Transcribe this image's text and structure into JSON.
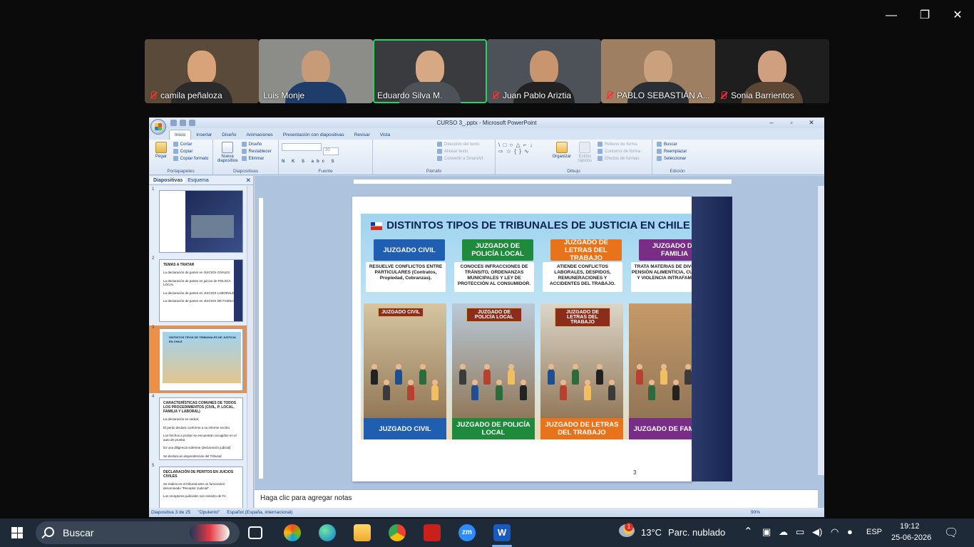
{
  "participants": [
    {
      "name": "camila peñaloza",
      "muted": true,
      "active": false,
      "bg": "#5a4a3a",
      "face": "#d9a37a",
      "body": "#2b2b2b"
    },
    {
      "name": "Luis Monje",
      "muted": false,
      "active": false,
      "bg": "#8c8c88",
      "face": "#c79b78",
      "body": "#1f3d6b"
    },
    {
      "name": "Eduardo Silva M.",
      "muted": false,
      "active": true,
      "bg": "#3a3b3f",
      "face": "#d6a883",
      "body": "#4c5258"
    },
    {
      "name": "Juan Pablo Ariztia",
      "muted": true,
      "active": false,
      "bg": "#4d5258",
      "face": "#c9956f",
      "body": "#222"
    },
    {
      "name": "PABLO SEBASTIÁN A...",
      "muted": true,
      "active": false,
      "bg": "#9e7f62",
      "face": "#caa07d",
      "body": "#2a2f35"
    },
    {
      "name": "Sonia Barrientos",
      "muted": true,
      "active": false,
      "bg": "#1e1e1e",
      "face": "#cf9f80",
      "body": "#5b4633"
    }
  ],
  "ppt": {
    "title": "CURSO 3_.pptx - Microsoft PowerPoint",
    "tabs": [
      "Inicio",
      "Insertar",
      "Diseño",
      "Animaciones",
      "Presentación con diapositivas",
      "Revisar",
      "Vista"
    ],
    "groups": {
      "portapapeles": {
        "label": "Portapapeles",
        "pegar": "Pegar",
        "cortar": "Cortar",
        "copiar": "Copiar",
        "copiar_formato": "Copiar formato"
      },
      "diapositivas": {
        "label": "Diapositivas",
        "nueva": "Nueva diapositiva",
        "diseno": "Diseño",
        "restablecer": "Restablecer",
        "eliminar": "Eliminar"
      },
      "fuente": {
        "label": "Fuente",
        "size": "20"
      },
      "parrafo": {
        "label": "Párrafo",
        "direccion": "Dirección del texto",
        "alinear": "Alinear texto",
        "convertir": "Convertir a SmartArt"
      },
      "dibujo": {
        "label": "Dibujo",
        "organizar": "Organizar",
        "estilos": "Estilos rápidos",
        "relleno": "Relleno de forma",
        "contorno": "Contorno de forma",
        "efectos": "Efectos de formas"
      },
      "edicion": {
        "label": "Edición",
        "buscar": "Buscar",
        "reemplazar": "Reemplazar",
        "seleccionar": "Seleccionar"
      }
    },
    "left_tabs": {
      "slides": "Diapositivas",
      "outline": "Esquema"
    },
    "thumbnails": [
      {
        "num": "1",
        "title": "",
        "lines": []
      },
      {
        "num": "2",
        "title": "TEMAS A TRATAR",
        "lines": [
          "La declaración de partes en JUICIOS CIVILES",
          "La declaración de partes en juicios de POLICÍA LOCAL",
          "La declaración de partes en JUICIOS LABORALES",
          "La declaración de partes en JUICIOS DE FAMILIA"
        ]
      },
      {
        "num": "3",
        "title": "DISTINTOS TIPOS DE TRIBUNALES DE JUSTICIA EN CHILE",
        "lines": []
      },
      {
        "num": "4",
        "title": "CARACTERÍSTICAS COMUNES DE TODOS LOS PROCEDIMIENTOS (CIVIL, P. LOCAL, FAMILIA Y LABORAL)",
        "lines": [
          "La declaración es verbal;",
          "El perito declara conforme a su informe escrito",
          "Los hechos a probar se encuentran recogidos en el auto de prueba",
          "Es una diligencia solemne (declaración judicial)",
          "Se declara en dependencias del Tribunal"
        ]
      },
      {
        "num": "5",
        "title": "DECLARACIÓN DE PERITOS EN JUICIOS CIVILES",
        "lines": [
          "Se realiza en el tribunal ante un funcionario denominado \"Receptor Judicial\".",
          "Los receptores judiciales son ministro de Fe"
        ]
      }
    ],
    "slide": {
      "title": "DISTINTOS TIPOS DE TRIBUNALES DE JUSTICIA EN CHILE",
      "number": "3",
      "columns": [
        {
          "header": "JUZGADO CIVIL",
          "color": "#1f5eb0",
          "desc": "RESUELVE CONFLICTOS ENTRE PARTICULARES (Contratos, Propiedad, Cobranzas).",
          "sign": "JUZGADO CIVIL",
          "footer": "JUZGADO CIVIL"
        },
        {
          "header": "JUZGADO DE POLICÍA LOCAL",
          "color": "#1e8a3c",
          "desc": "CONOCES INFRACCIONES DE TRÁNSITO, ORDENANZAS MUNICIPALES Y LEY DE PROTECCIÓN AL CONSUMIDOR.",
          "sign": "JUZGADO DE POLICÍA LOCAL",
          "footer": "JUZGADO DE POLICÍA LOCAL"
        },
        {
          "header": "JUZGADO DE LETRAS DEL TRABAJO",
          "color": "#e8731a",
          "desc": "ATIENDE CONFLICTOS LABORALES, DESPIDOS, REMUNERACIONES Y ACCIDENTES DEL TRABAJO.",
          "sign": "JUZGADO DE LETRAS DEL TRABAJO",
          "footer": "JUZGADO DE LETRAS DEL TRABAJO"
        },
        {
          "header": "JUZGADO DE FAMILIA",
          "color": "#7a2d86",
          "desc": "TRATA MATERIAS DE DIVORCIO, PENSIÓN ALIMENTICIA, CUSTODIA Y VIOLENCIA INTRAFAMILIAR.",
          "sign": "",
          "footer": "JUZGADO DE FAMILIA"
        }
      ]
    },
    "notes_placeholder": "Haga clic para agregar notas",
    "status": {
      "slide_info": "Diapositiva 3 de 25",
      "theme": "\"Opulento\"",
      "language": "Español (España, internacional)",
      "zoom": "90%"
    }
  },
  "taskbar": {
    "search": "Buscar",
    "weather_temp": "13°C",
    "weather_desc": "Parc. nublado",
    "lang": "ESP",
    "time": "19:12",
    "date": "25-06-2026",
    "weather_badge": "1"
  }
}
